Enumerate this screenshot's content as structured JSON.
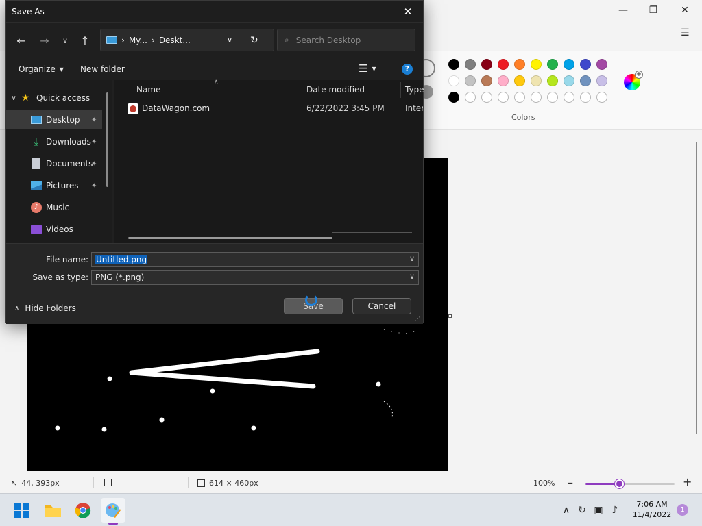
{
  "dialog": {
    "title": "Save As",
    "breadcrumb": [
      "My...",
      "Deskt..."
    ],
    "search_placeholder": "Search Desktop",
    "organize_label": "Organize",
    "new_folder_label": "New folder",
    "nav": {
      "quick_access": "Quick access",
      "items": [
        {
          "label": "Desktop",
          "icon": "desktop-icon",
          "pinned": true,
          "selected": true
        },
        {
          "label": "Downloads",
          "icon": "downloads-icon",
          "pinned": true
        },
        {
          "label": "Documents",
          "icon": "documents-icon",
          "pinned": true
        },
        {
          "label": "Pictures",
          "icon": "pictures-icon",
          "pinned": true
        },
        {
          "label": "Music",
          "icon": "music-icon",
          "pinned": false
        },
        {
          "label": "Videos",
          "icon": "videos-icon",
          "pinned": false
        }
      ]
    },
    "columns": [
      "Name",
      "Date modified",
      "Type"
    ],
    "files": [
      {
        "name": "DataWagon.com",
        "date": "6/22/2022 3:45 PM",
        "type": "Interr"
      }
    ],
    "file_name_label": "File name:",
    "file_name_value": "Untitled.png",
    "save_type_label": "Save as type:",
    "save_type_value": "PNG (*.png)",
    "save_label": "Save",
    "cancel_label": "Cancel",
    "hide_folders_label": "Hide Folders"
  },
  "paint": {
    "colors_label": "Colors",
    "palette_row1": [
      "#000000",
      "#7f7f7f",
      "#880015",
      "#ed1c24",
      "#ff7f27",
      "#fff200",
      "#22b14c",
      "#00a2e8",
      "#3f48cc",
      "#a349a4"
    ],
    "palette_row2": [
      "#ffffff",
      "#c3c3c3",
      "#b97a57",
      "#ffaec9",
      "#ffc90e",
      "#efe4b0",
      "#b5e61d",
      "#99d9ea",
      "#7092be",
      "#c8bfe7"
    ],
    "palette_row3": [
      "#000000",
      "",
      "",
      "",
      "",
      "",
      "",
      "",
      "",
      ""
    ],
    "cursor_pos": "44, 393px",
    "canvas_size": "614 × 460px",
    "zoom": "100%",
    "zoom_fraction": 0.38,
    "accent": "#8e3bbf"
  },
  "taskbar": {
    "time": "7:06 AM",
    "date": "11/4/2022",
    "notifications": "1"
  }
}
